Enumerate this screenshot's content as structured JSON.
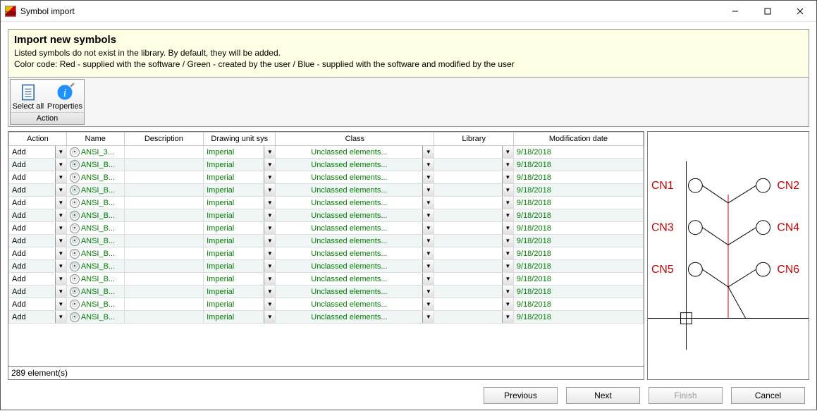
{
  "window": {
    "title": "Symbol import",
    "app_icon_text": "2019"
  },
  "banner": {
    "title": "Import new symbols",
    "line1": "Listed symbols do not exist in the library. By default, they will be added.",
    "line2": "Color code: Red - supplied with the software / Green - created by the user / Blue - supplied with the software and modified by the user"
  },
  "ribbon": {
    "select_all": "Select all",
    "properties": "Properties",
    "group_label": "Action"
  },
  "columns": {
    "action": "Action",
    "name": "Name",
    "description": "Description",
    "unit": "Drawing unit sys",
    "class": "Class",
    "library": "Library",
    "date": "Modification date"
  },
  "row_values": {
    "action": "Add",
    "unit": "Imperial",
    "class": "Unclassed elements...",
    "date": "9/18/2018"
  },
  "rows": [
    {
      "name": "ANSI_3..."
    },
    {
      "name": "ANSI_B..."
    },
    {
      "name": "ANSI_B..."
    },
    {
      "name": "ANSI_B..."
    },
    {
      "name": "ANSI_B..."
    },
    {
      "name": "ANSI_B..."
    },
    {
      "name": "ANSI_B..."
    },
    {
      "name": "ANSI_B..."
    },
    {
      "name": "ANSI_B..."
    },
    {
      "name": "ANSI_B..."
    },
    {
      "name": "ANSI_B..."
    },
    {
      "name": "ANSI_B..."
    },
    {
      "name": "ANSI_B..."
    },
    {
      "name": "ANSI_B..."
    }
  ],
  "status": "289 element(s)",
  "preview": {
    "labels": [
      "CN1",
      "CN2",
      "CN3",
      "CN4",
      "CN5",
      "CN6"
    ]
  },
  "footer": {
    "previous": "Previous",
    "next": "Next",
    "finish": "Finish",
    "cancel": "Cancel"
  }
}
